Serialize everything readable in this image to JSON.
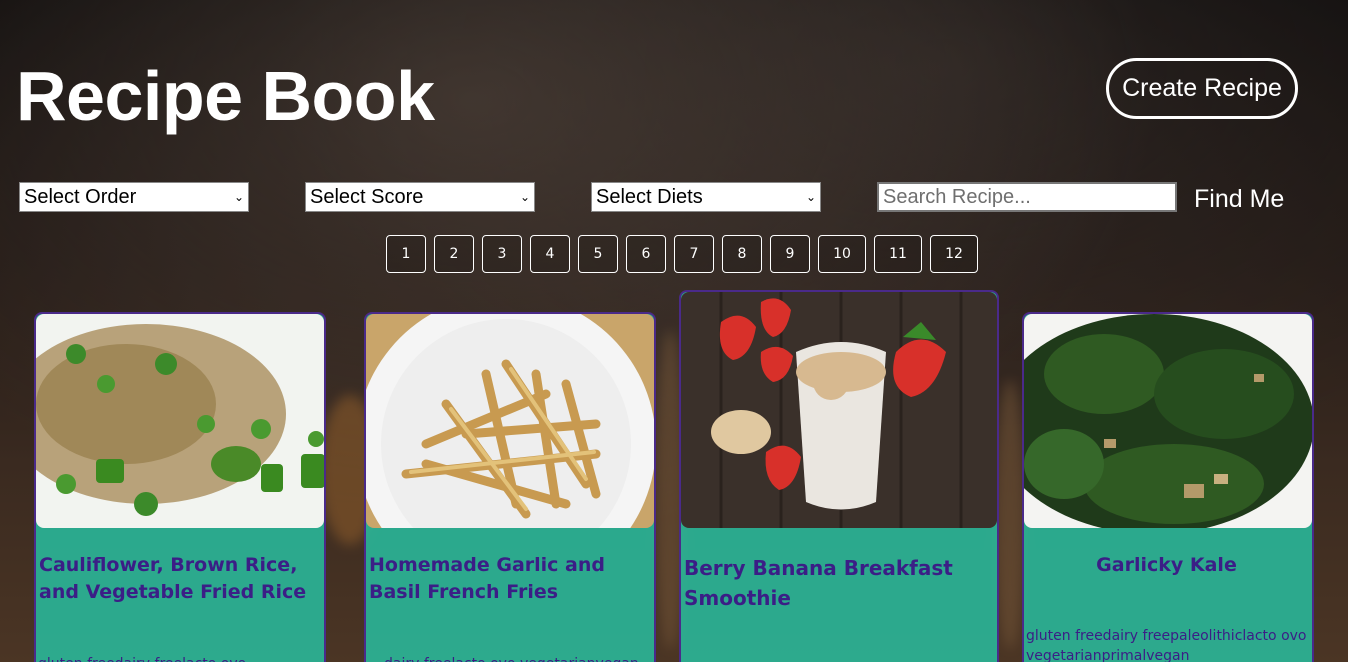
{
  "header": {
    "title": "Recipe Book",
    "create_label": "Create Recipe"
  },
  "filters": {
    "order": "Select Order",
    "score": "Select Score",
    "diets": "Select Diets",
    "search_placeholder": "Search Recipe...",
    "find_label": "Find Me"
  },
  "pagination": [
    "1",
    "2",
    "3",
    "4",
    "5",
    "6",
    "7",
    "8",
    "9",
    "10",
    "11",
    "12"
  ],
  "recipes": [
    {
      "name": "Cauliflower, Brown Rice, and Vegetable Fried Rice",
      "diets": "gluten freedairy freelacto ovo vegetarianvegan"
    },
    {
      "name": "Homemade Garlic and Basil French Fries",
      "diets": "dairy freelacto ovo vegetarianvegan"
    },
    {
      "name": "Berry Banana Breakfast Smoothie",
      "diets": ""
    },
    {
      "name": "Garlicky Kale",
      "diets": "gluten freedairy freepaleolithiclacto ovo vegetarianprimalvegan"
    }
  ],
  "colors": {
    "card_bg": "#28bea0",
    "card_border": "#4a2a8a",
    "card_text": "#3b1e86"
  }
}
